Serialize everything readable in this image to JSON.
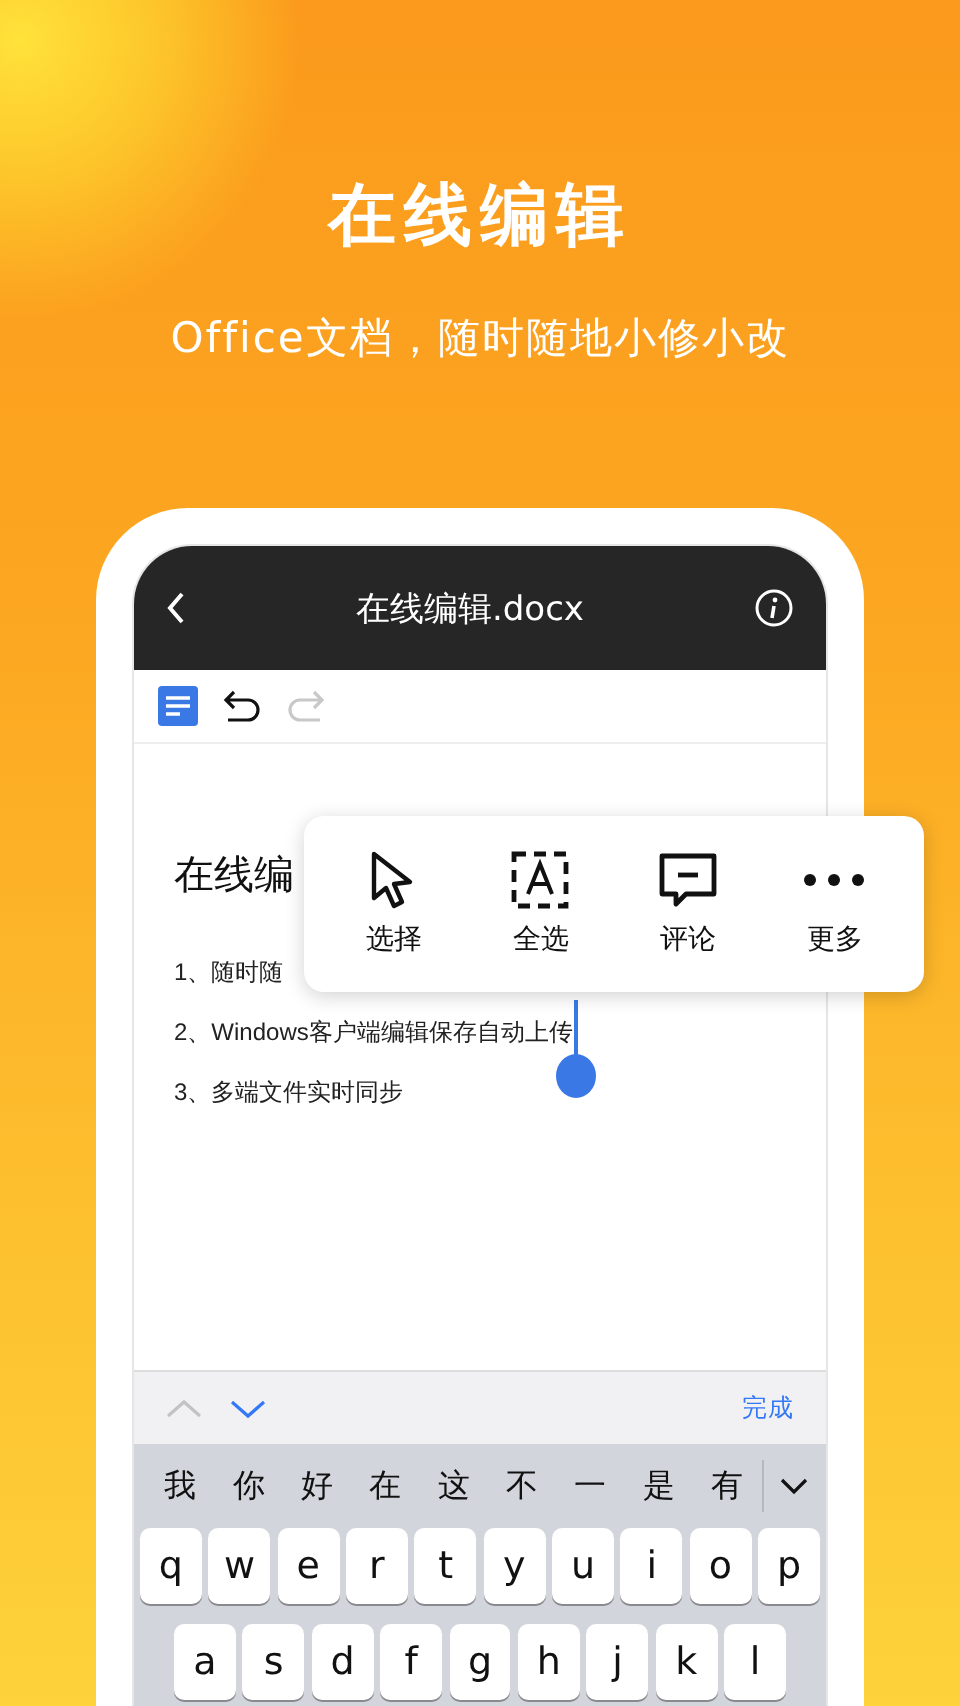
{
  "headline": "在线编辑",
  "subtitle": "Office文档，随时随地小修小改",
  "phone": {
    "title": "在线编辑.docx",
    "toolbar": [
      {
        "kind": "outline",
        "disabled": false
      },
      {
        "kind": "undo",
        "disabled": false
      },
      {
        "kind": "redo",
        "disabled": true
      }
    ],
    "document": {
      "heading": "在线编",
      "items": [
        "1、随时随",
        "2、Windows客户端编辑保存自动上传",
        "3、多端文件实时同步"
      ]
    },
    "context_menu": [
      {
        "kind": "select",
        "label": "选择"
      },
      {
        "kind": "select_all",
        "label": "全选"
      },
      {
        "kind": "comment",
        "label": "评论"
      },
      {
        "kind": "more",
        "label": "更多"
      }
    ],
    "keyboard": {
      "nav": [
        {
          "kind": "up",
          "disabled": true
        },
        {
          "kind": "down",
          "disabled": false
        }
      ],
      "done": "完成",
      "candidates": [
        "我",
        "你",
        "好",
        "在",
        "这",
        "不",
        "一",
        "是",
        "有"
      ],
      "rows": [
        [
          "q",
          "w",
          "e",
          "r",
          "t",
          "y",
          "u",
          "i",
          "o",
          "p"
        ],
        [
          "a",
          "s",
          "d",
          "f",
          "g",
          "h",
          "j",
          "k",
          "l"
        ]
      ]
    }
  }
}
